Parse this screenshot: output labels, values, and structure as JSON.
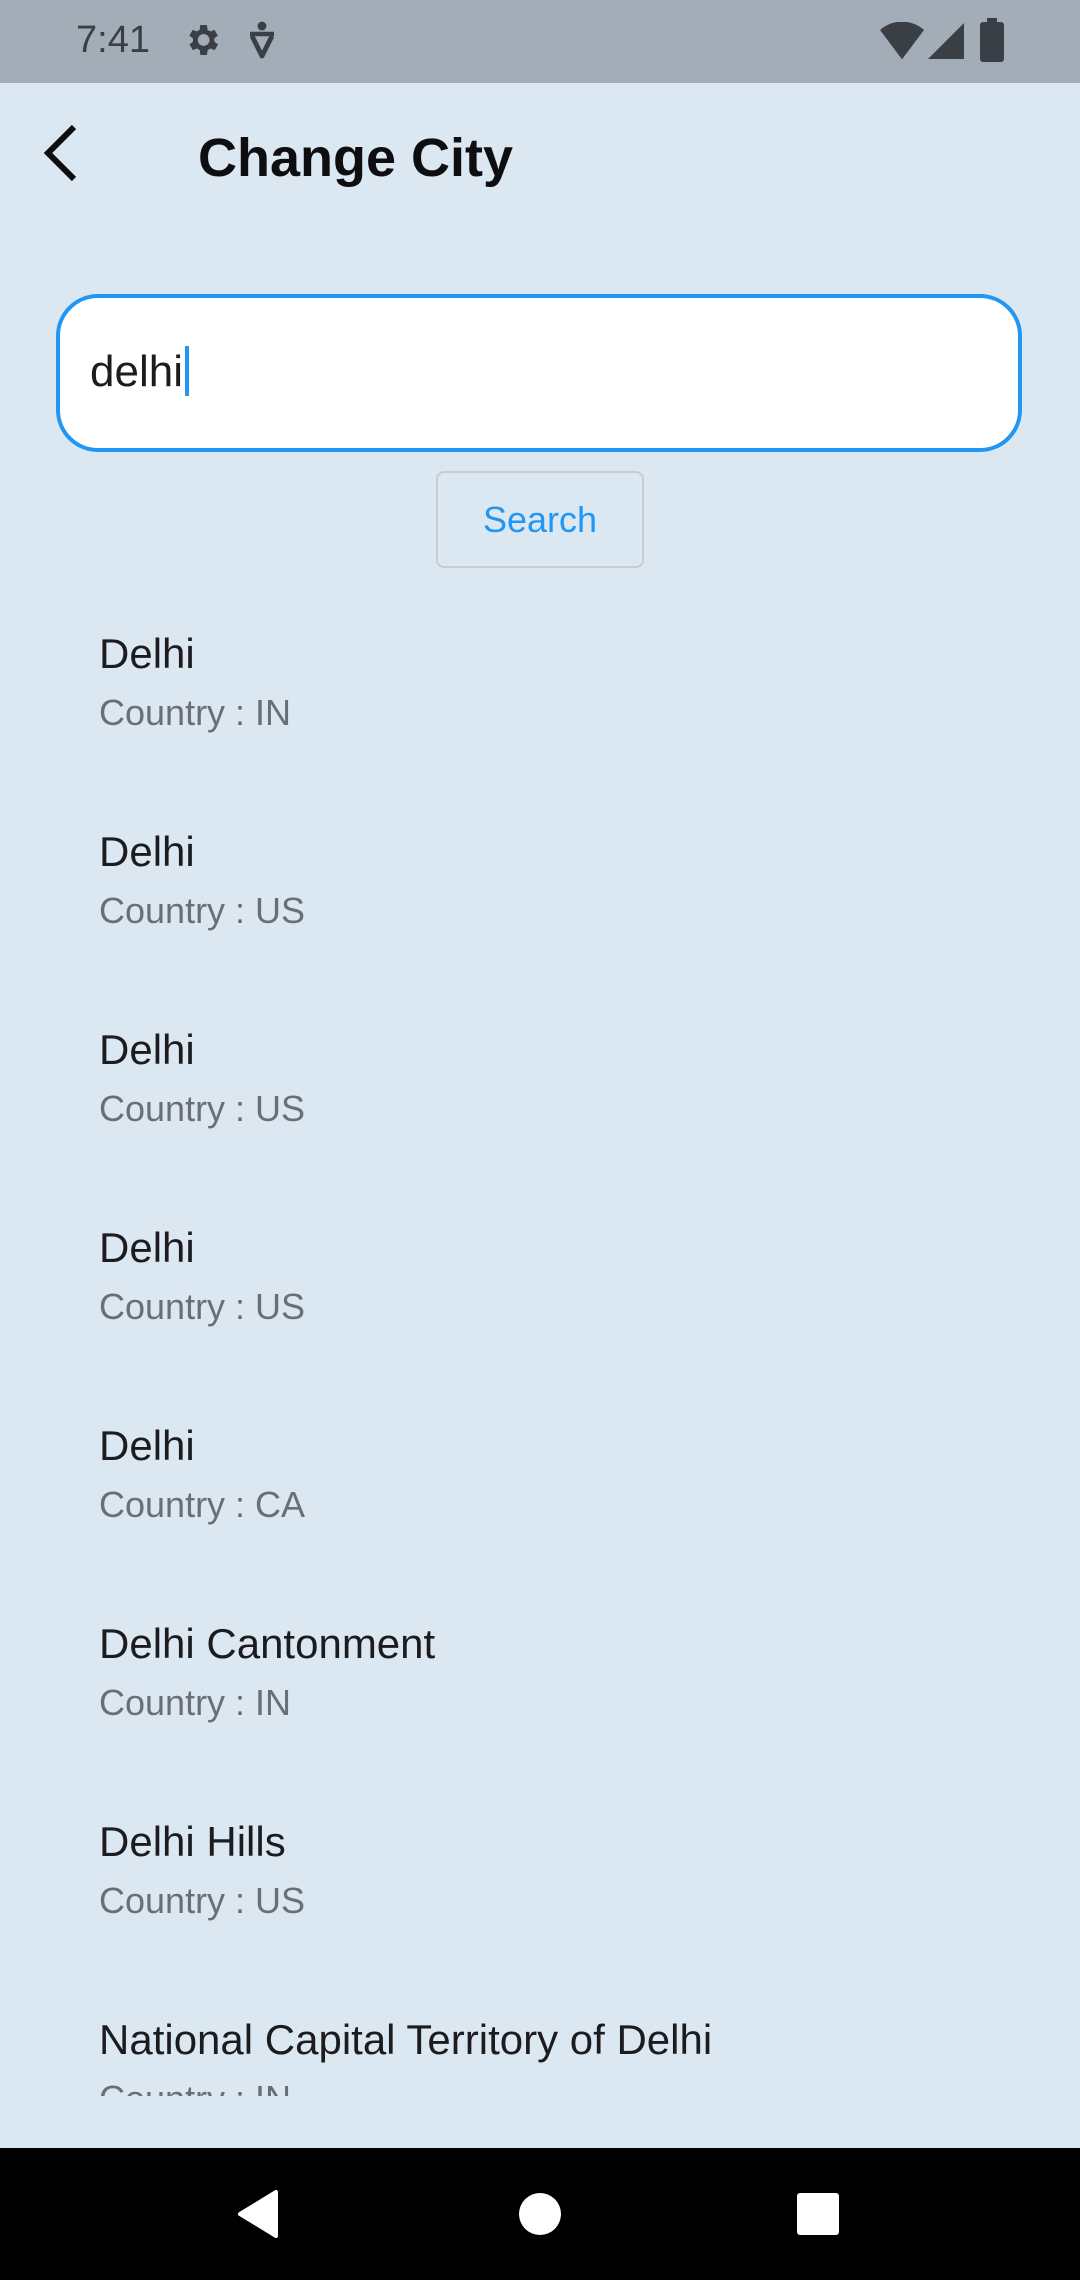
{
  "status_bar": {
    "time": "7:41",
    "icons_left": [
      "gear-icon",
      "accessibility-icon"
    ],
    "icons_right": [
      "wifi-icon",
      "signal-icon",
      "battery-icon"
    ]
  },
  "app_bar": {
    "title": "Change City",
    "back_icon": "back-arrow-icon"
  },
  "search": {
    "value": "delhi",
    "button_label": "Search",
    "accent_color": "#2196f3"
  },
  "results": [
    {
      "name": "Delhi",
      "country": "Country : IN"
    },
    {
      "name": "Delhi",
      "country": "Country : US"
    },
    {
      "name": "Delhi",
      "country": "Country : US"
    },
    {
      "name": "Delhi",
      "country": "Country : US"
    },
    {
      "name": "Delhi",
      "country": "Country : CA"
    },
    {
      "name": "Delhi Cantonment",
      "country": "Country : IN"
    },
    {
      "name": "Delhi Hills",
      "country": "Country : US"
    },
    {
      "name": "National Capital Territory of Delhi",
      "country": "Country : IN"
    }
  ],
  "nav_bar": {
    "buttons": [
      "back-triangle-icon",
      "home-circle-icon",
      "recents-square-icon"
    ]
  }
}
